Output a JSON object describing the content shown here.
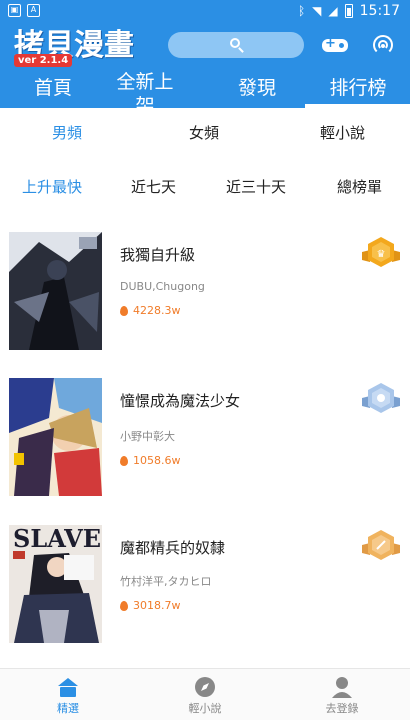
{
  "status_bar": {
    "time": "15:17",
    "left_icons": [
      "image-icon",
      "text-icon"
    ],
    "right_icons": [
      "bluetooth-icon",
      "wifi-icon",
      "signal-icon",
      "battery-icon"
    ]
  },
  "header": {
    "app_title": "拷貝漫畫",
    "version": "ver 2.1.4",
    "search_icon": "search-icon",
    "game_icon": "gamepad-icon",
    "broadcast_icon": "broadcast-icon"
  },
  "main_tabs": {
    "items": [
      "首頁",
      "全新上架",
      "發現",
      "排行榜"
    ],
    "selected": "排行榜"
  },
  "gender_tabs": {
    "items": [
      "男頻",
      "女頻",
      "輕小說"
    ],
    "selected": "男頻"
  },
  "rank_tabs": {
    "items": [
      "上升最快",
      "近七天",
      "近三十天",
      "總榜單"
    ],
    "selected": "上升最快"
  },
  "rankings": [
    {
      "title": "我獨自升級",
      "author": "DUBU,Chugong",
      "heat": "4228.3w",
      "badge": "gold",
      "badge_color": "#f3a81d"
    },
    {
      "title": "憧憬成為魔法少女",
      "author": "小野中彰大",
      "heat": "1058.6w",
      "badge": "silver",
      "badge_color": "#8fb4e0"
    },
    {
      "title": "魔都精兵的奴隸",
      "author": "竹村洋平,タカヒロ",
      "heat": "3018.7w",
      "badge": "bronze",
      "badge_color": "#f0b35e"
    }
  ],
  "bottom_nav": {
    "items": [
      {
        "label": "精選",
        "icon": "home-icon"
      },
      {
        "label": "輕小說",
        "icon": "compass-icon"
      },
      {
        "label": "去登錄",
        "icon": "user-icon"
      }
    ],
    "selected": "精選"
  },
  "colors": {
    "accent": "#2b8fe4",
    "heat": "#f07c2a",
    "version_badge": "#e53935"
  }
}
